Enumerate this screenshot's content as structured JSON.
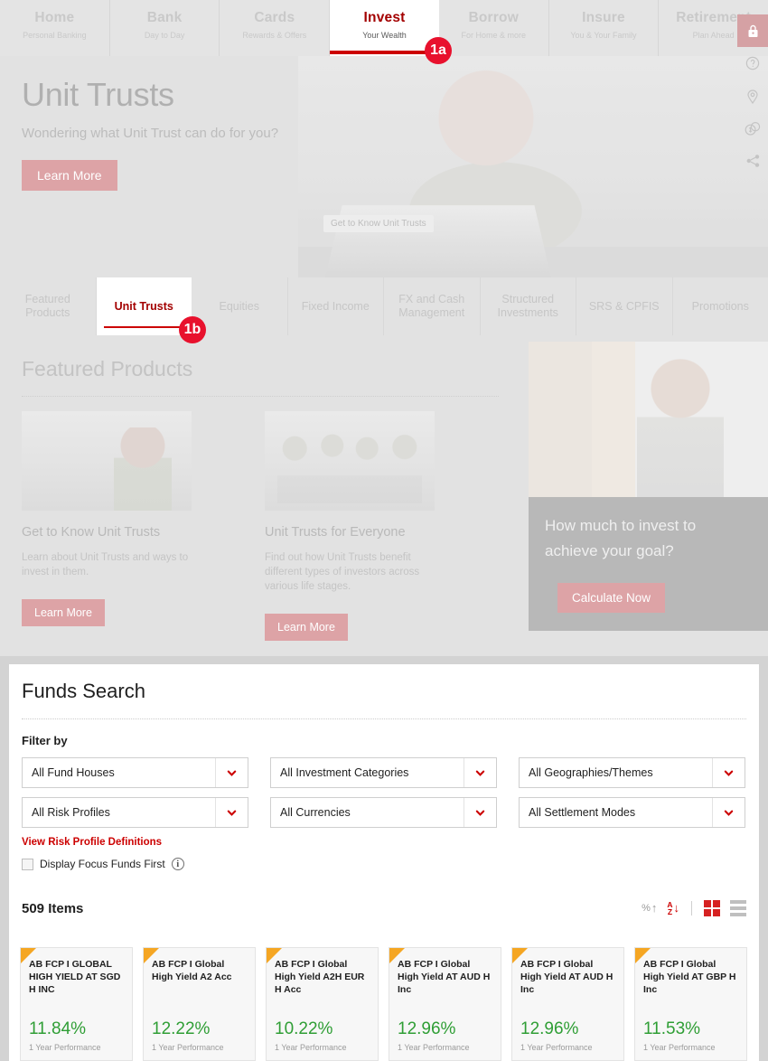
{
  "topnav": {
    "items": [
      {
        "title": "Home",
        "sub": "Personal Banking",
        "active": false
      },
      {
        "title": "Bank",
        "sub": "Day to Day",
        "active": false
      },
      {
        "title": "Cards",
        "sub": "Rewards & Offers",
        "active": false
      },
      {
        "title": "Invest",
        "sub": "Your Wealth",
        "active": true
      },
      {
        "title": "Borrow",
        "sub": "For Home & more",
        "active": false
      },
      {
        "title": "Insure",
        "sub": "You & Your Family",
        "active": false
      },
      {
        "title": "Retirement",
        "sub": "Plan Ahead",
        "active": false
      }
    ]
  },
  "badges": {
    "a": "1a",
    "b": "1b",
    "color": "#e8112d"
  },
  "hero": {
    "title": "Unit Trusts",
    "subtitle": "Wondering what Unit Trust can do for you?",
    "button": "Learn More",
    "image_tooltip": "Get to Know Unit Trusts"
  },
  "rail": {
    "items": [
      {
        "name": "lock-icon",
        "label": "Login"
      },
      {
        "name": "help-icon",
        "label": "Help"
      },
      {
        "name": "location-pin-icon",
        "label": "Locate Us"
      },
      {
        "name": "rates-icon",
        "label": "Rates"
      },
      {
        "name": "share-icon",
        "label": "Share"
      }
    ]
  },
  "subtabs": {
    "items": [
      {
        "label": "Featured Products",
        "active": false
      },
      {
        "label": "Unit Trusts",
        "active": true
      },
      {
        "label": "Equities",
        "active": false
      },
      {
        "label": "Fixed Income",
        "active": false
      },
      {
        "label": "FX and Cash Management",
        "active": false
      },
      {
        "label": "Structured Investments",
        "active": false
      },
      {
        "label": "SRS & CPFIS",
        "active": false
      },
      {
        "label": "Promotions",
        "active": false
      }
    ]
  },
  "featured": {
    "heading": "Featured Products",
    "cards": [
      {
        "title": "Get to Know Unit Trusts",
        "desc": "Learn about Unit Trusts and ways to invest in them.",
        "button": "Learn More"
      },
      {
        "title": "Unit Trusts for Everyone",
        "desc": "Find out how Unit Trusts benefit different types of investors across various life stages.",
        "button": "Learn More"
      }
    ],
    "promo": {
      "headline": "How much to invest to achieve your goal?",
      "button": "Calculate Now"
    }
  },
  "funds_search": {
    "title": "Funds Search",
    "filter_by": "Filter by",
    "filters": [
      {
        "name": "fund-houses",
        "value": "All Fund Houses"
      },
      {
        "name": "investment-categories",
        "value": "All Investment Categories"
      },
      {
        "name": "geographies-themes",
        "value": "All Geographies/Themes"
      },
      {
        "name": "risk-profiles",
        "value": "All Risk Profiles"
      },
      {
        "name": "currencies",
        "value": "All Currencies"
      },
      {
        "name": "settlement-modes",
        "value": "All Settlement Modes"
      }
    ],
    "risk_link": "View Risk Profile Definitions",
    "focus_checkbox_label": "Display Focus Funds First",
    "focus_checkbox_checked": false,
    "items_count": "509 Items",
    "sort": {
      "percent_label": "%",
      "percent_arrow": "↑",
      "az_top": "A",
      "az_bottom": "Z",
      "az_arrow": "↓",
      "grid_active": true,
      "list_active": false
    },
    "accent_red": "#cc0000",
    "performance_green": "#2f9e35",
    "focus_flag_orange": "#f5a623"
  },
  "fund_results": {
    "performance_caption": "1 Year Performance",
    "items": [
      {
        "name": "AB FCP I GLOBAL HIGH YIELD AT SGD H INC",
        "performance": "11.84%"
      },
      {
        "name": "AB FCP I Global High Yield A2 Acc",
        "performance": "12.22%"
      },
      {
        "name": "AB FCP I Global High Yield A2H EUR H Acc",
        "performance": "10.22%"
      },
      {
        "name": "AB FCP I Global High Yield AT AUD H Inc",
        "performance": "12.96%"
      },
      {
        "name": "AB FCP I Global High Yield AT AUD H Inc",
        "performance": "12.96%"
      },
      {
        "name": "AB FCP I Global High Yield AT GBP H Inc",
        "performance": "11.53%"
      }
    ]
  }
}
